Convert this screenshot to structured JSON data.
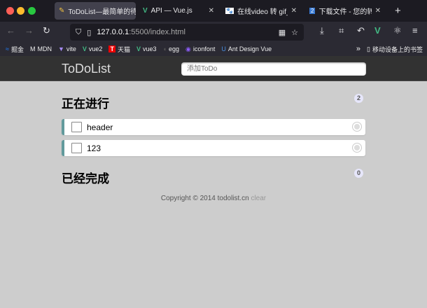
{
  "browser": {
    "tabs": [
      {
        "title": "ToDoList—最简单的待",
        "active": true
      },
      {
        "title": "API — Vue.js",
        "active": false
      },
      {
        "title": "在线video 转 gif_百度",
        "active": false
      },
      {
        "title": "下载文件 - 您的转换",
        "active": false
      }
    ],
    "url_host": "127.0.0.1",
    "url_rest": ":5500/index.html",
    "bookmarks": [
      "掘金",
      "MDN",
      "vite",
      "vue2",
      "天猫",
      "vue3",
      "egg",
      "iconfont",
      "Ant Design Vue"
    ],
    "mobile_bookmarks": "移动设备上的书签"
  },
  "app": {
    "title": "ToDoList",
    "input_placeholder": "添加ToDo",
    "doing": {
      "heading": "正在进行",
      "count": "2",
      "items": [
        "header",
        "123"
      ]
    },
    "done": {
      "heading": "已经完成",
      "count": "0",
      "items": []
    },
    "footer": {
      "text": "Copyright © 2014 todolist.cn",
      "clear": "clear"
    }
  }
}
